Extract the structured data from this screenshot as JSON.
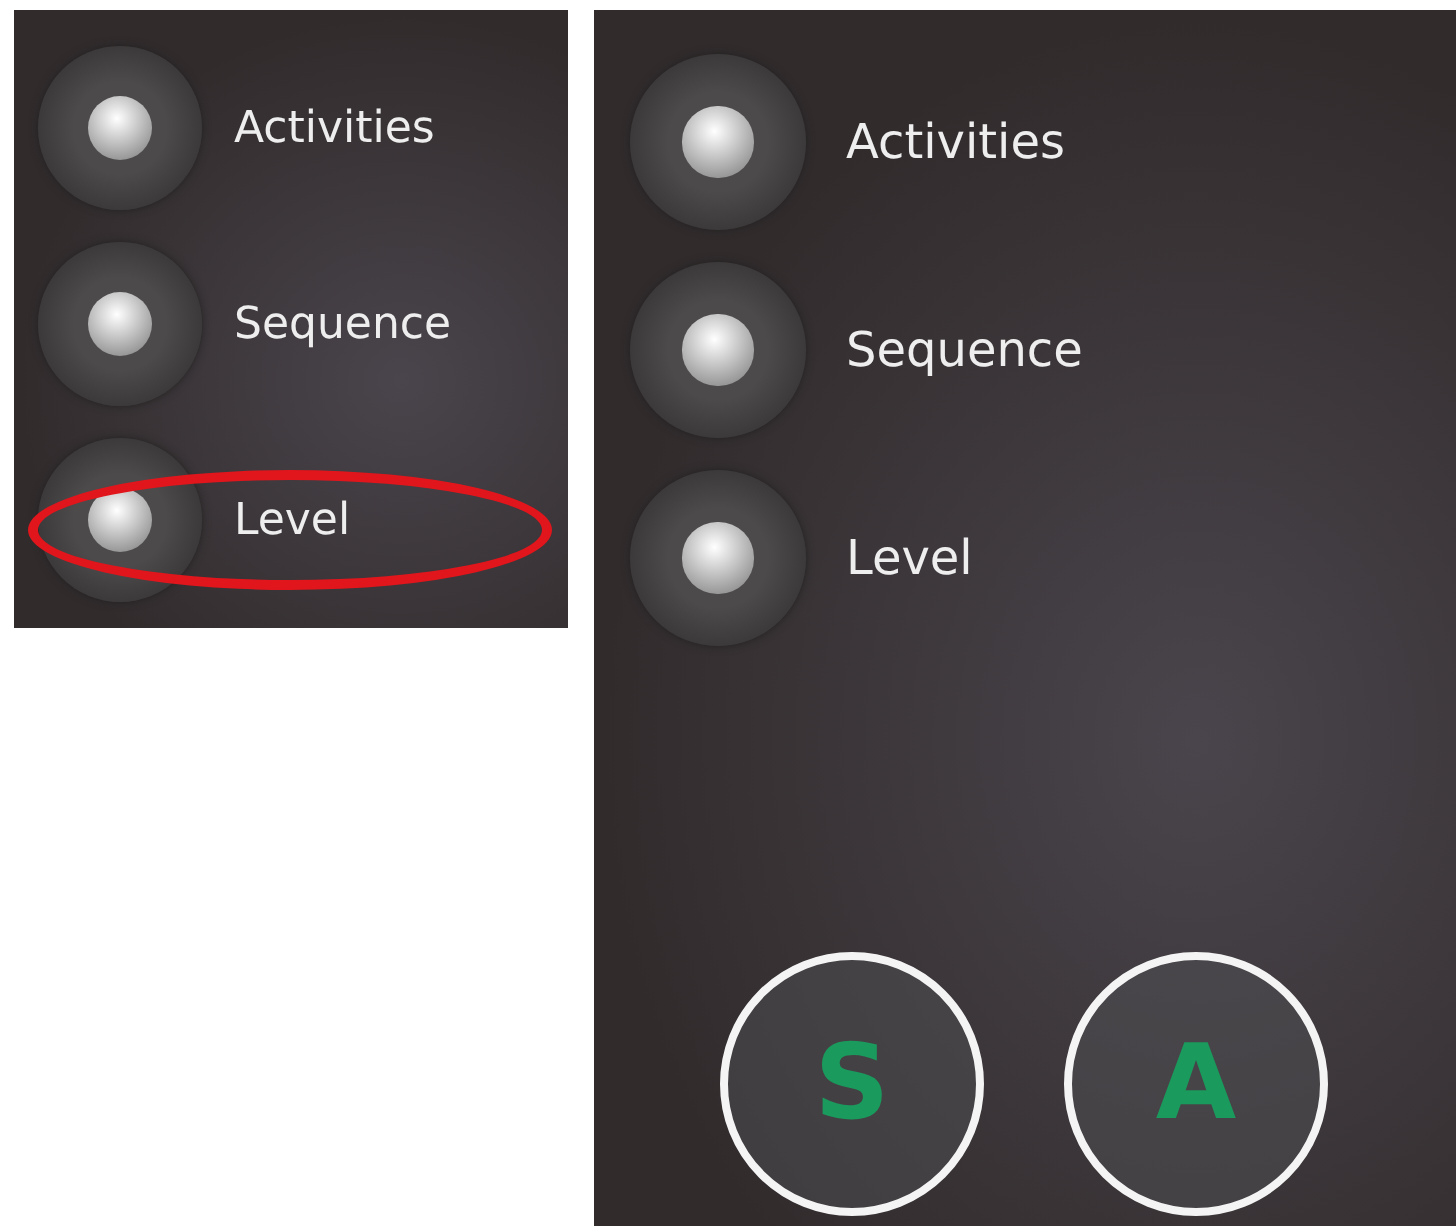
{
  "panels": [
    {
      "menu": [
        {
          "label": "Activities",
          "highlighted": false
        },
        {
          "label": "Sequence",
          "highlighted": false
        },
        {
          "label": "Level",
          "highlighted": true
        }
      ]
    },
    {
      "menu": [
        {
          "label": "Activities",
          "highlighted": false
        },
        {
          "label": "Sequence",
          "highlighted": false
        },
        {
          "label": "Level",
          "highlighted": false
        }
      ],
      "buttons": [
        {
          "label": "S"
        },
        {
          "label": "A"
        }
      ]
    }
  ]
}
